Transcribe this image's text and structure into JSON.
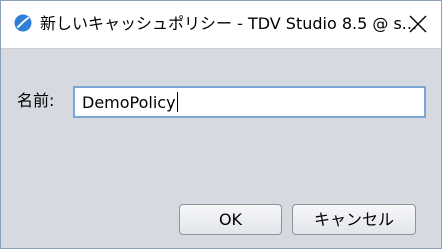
{
  "window": {
    "title": "新しいキャッシュポリシー - TDV Studio 8.5 @ s...",
    "close_icon": "close-icon",
    "app_icon": "tdv-studio-icon"
  },
  "form": {
    "name_label": "名前:",
    "name_value": "DemoPolicy"
  },
  "buttons": {
    "ok_label": "OK",
    "cancel_label": "キャンセル"
  },
  "colors": {
    "dialog_background": "#d6d9df",
    "input_focus_border": "#7aa6d8",
    "app_icon_blue": "#2f7fd8"
  }
}
